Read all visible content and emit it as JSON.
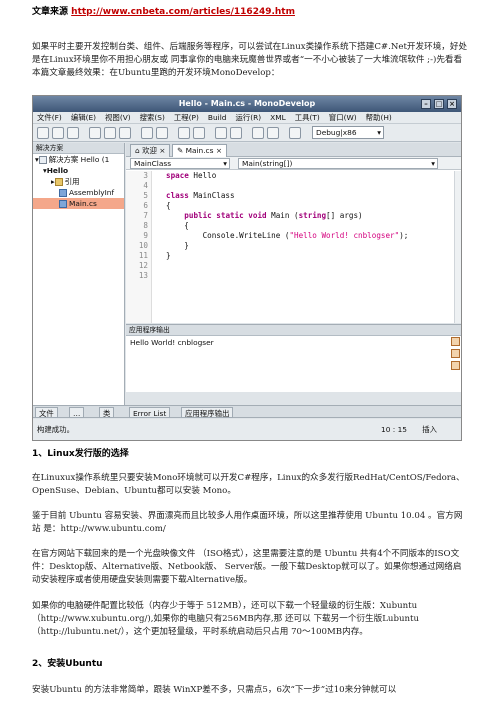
{
  "source": {
    "label": "文章来源",
    "url": "http://www.cnbeta.com/articles/116249.htm"
  },
  "intro": "如果平时主要开发控制台类、组件、后端服务等程序，可以尝试在Linux类操作系统下搭建C#.Net开发环境，好处是在Linux环境里你不用担心朋友或 同事拿你的电脑来玩魔兽世界或者“一不小心被装了一大堆流氓软件 ;-)先看看本篇文章最终效果：在Ubuntu里跑的开发环境MonoDevelop：",
  "screenshot": {
    "title": "Hello - Main.cs - MonoDevelop",
    "menu": [
      "文件(F)",
      "编辑(E)",
      "视图(V)",
      "搜索(S)",
      "工程(P)",
      "Build",
      "运行(R)",
      "XML",
      "工具(T)",
      "窗口(W)",
      "帮助(H)"
    ],
    "config_combo": "Debug|x86",
    "solution_pane_title": "解决方案",
    "tree": [
      "解决方案 Hello (1",
      "Hello",
      "引用",
      "AssemblyInf",
      "Main.cs"
    ],
    "tabs": [
      "欢迎",
      "Main.cs"
    ],
    "nav_class": "MainClass",
    "nav_method": "Main(string[])",
    "line_numbers": [
      "3",
      "4",
      "5",
      "6",
      "7",
      "8",
      "9",
      "10",
      "11",
      "12",
      "13"
    ],
    "output_title": "应用程序输出",
    "output_text": "Hello World! cnblogser",
    "bottom_tabs": [
      "文件",
      "…",
      "类",
      "Error List",
      "应用程序输出"
    ],
    "status": "构建成功。",
    "position": "10 : 15",
    "insert_mode": "插入"
  },
  "section1": {
    "heading": "1、Linux发行版的选择",
    "p1": "在Linuxux操作系统里只要安装Mono环境就可以开发C#程序，Linux的众多发行版RedHat/CentOS/Fedora、OpenSuse、Debian、Ubuntu都可以安装 Mono。",
    "p2": "鉴于目前 Ubuntu 容易安装、界面漂亮而且比较多人用作桌面环境，所以这里推荐使用 Ubuntu 10.04 。官方网站 是：http://www.ubuntu.com/",
    "p3": "在官方网站下载回来的是一个光盘映像文件 （ISO格式），这里需要注意的是 Ubuntu 共有4个不同版本的ISO文件：Desktop版、Alternative版、Netbook版、 Server版。一般下载Desktop就可以了。如果你想通过网络启动安装程序或者使用硬盘安装则需要下载Alternative版。",
    "p4": "如果你的电脑硬件配置比较低（内存少于等于 512MB），还可以下载一个轻量级的衍生版：Xubuntu（http://www.xubuntu.org/),如果你的电脑只有256MB内存,那 还可以 下载另一个衍生版Lubuntu（http://lubuntu.net/），这个更加轻量级，平时系统启动后只占用 70～100MB内存。"
  },
  "section2": {
    "heading": "2、安装Ubuntu",
    "p1": "安装Ubuntu 的方法非常简单，跟装 WinXP差不多，只需点5，6次“下一步”过10来分钟就可以"
  }
}
